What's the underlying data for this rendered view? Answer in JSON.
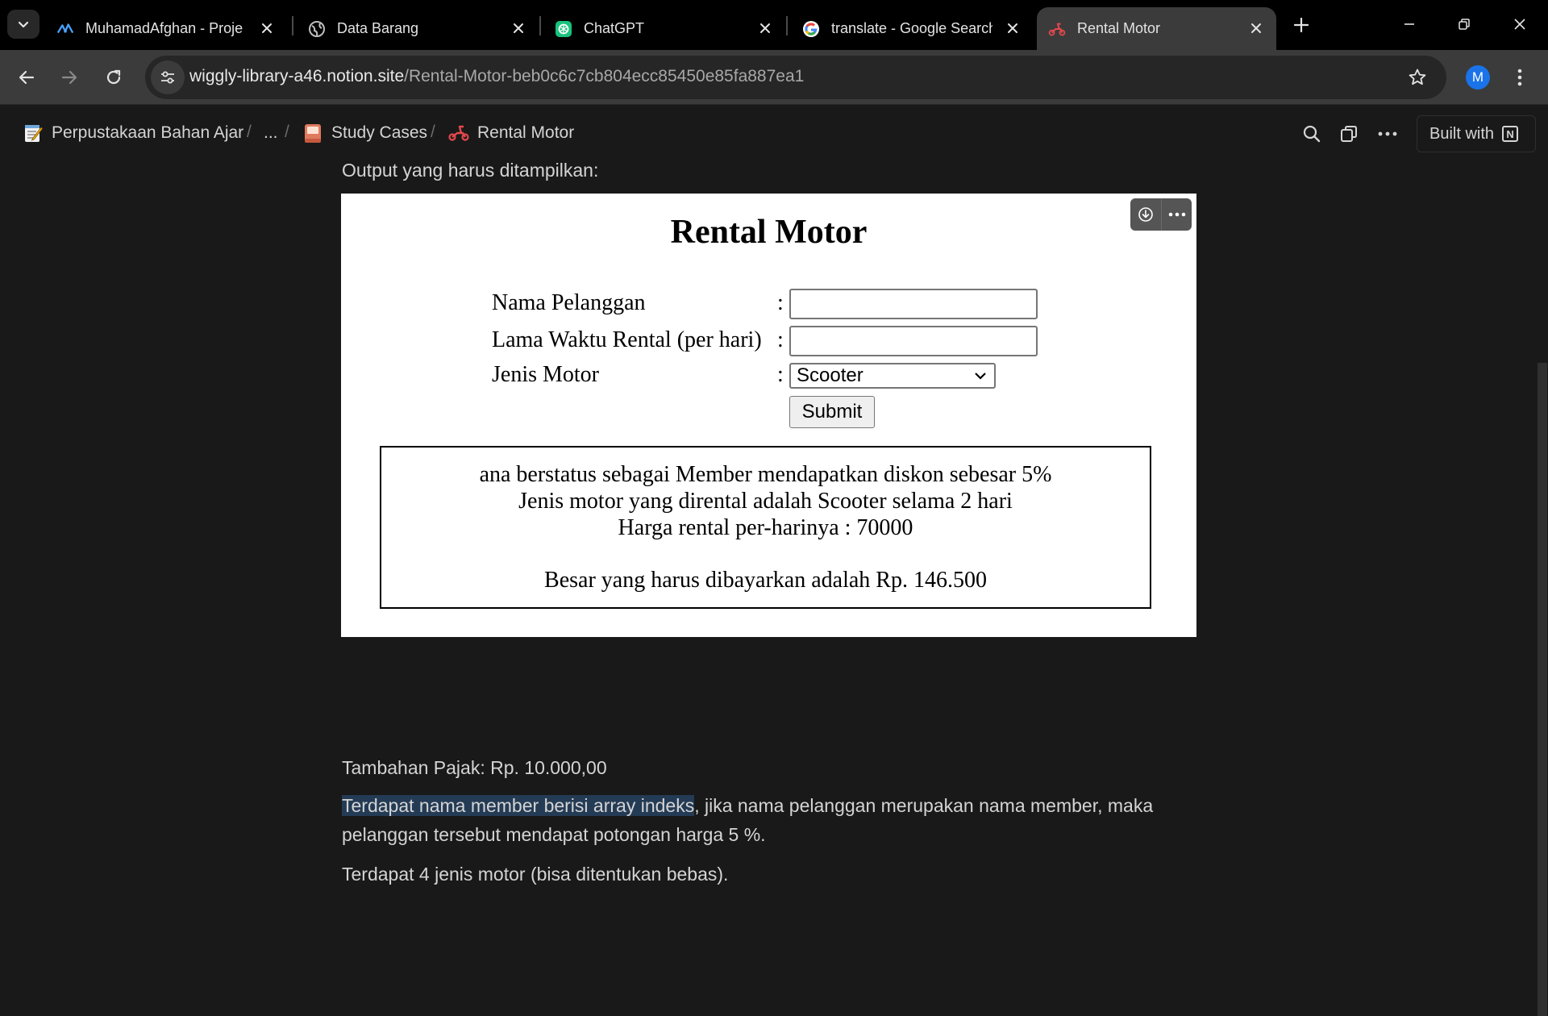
{
  "browser": {
    "tabs": [
      {
        "title": "MuhamadAfghan - Proje",
        "favicon": "blue-asterisk-icon",
        "active": false
      },
      {
        "title": "Data Barang",
        "favicon": "globe-icon",
        "active": false
      },
      {
        "title": "ChatGPT",
        "favicon": "chatgpt-icon",
        "active": false
      },
      {
        "title": "translate - Google Search",
        "favicon": "google-icon",
        "active": false
      },
      {
        "title": "Rental Motor",
        "favicon": "scooter-icon",
        "active": true
      }
    ],
    "url_host": "wiggly-library-a46.notion.site",
    "url_path": "/Rental-Motor-beb0c6c7cb804ecc85450e85fa887ea1",
    "profile_initial": "M",
    "accent_color": "#1a73e8"
  },
  "notion": {
    "breadcrumb": [
      {
        "label": "Perpustakaan Bahan Ajar",
        "icon": "memo-icon"
      },
      {
        "label": "...",
        "icon": ""
      },
      {
        "label": "Study Cases",
        "icon": "book-icon"
      },
      {
        "label": "Rental Motor",
        "icon": "scooter-icon"
      }
    ],
    "built_with_label": "Built with",
    "intro_text": "Output yang harus ditampilkan:",
    "paragraph_tax": "Tambahan Pajak: Rp. 10.000,00",
    "paragraph_member_highlight": "Terdapat nama member berisi array indeks",
    "paragraph_member_rest": ", jika nama pelanggan merupakan nama member, maka",
    "paragraph_member_line2": "pelanggan tersebut mendapat potongan harga 5 %.",
    "paragraph_types": "Terdapat 4 jenis motor (bisa ditentukan bebas).",
    "highlight_color": "#243b55"
  },
  "embed": {
    "title": "Rental Motor",
    "fields": [
      {
        "label": "Nama Pelanggan",
        "value": ""
      },
      {
        "label": "Lama Waktu Rental (per hari)",
        "value": ""
      }
    ],
    "select_label": "Jenis Motor",
    "select_value": "Scooter",
    "colon": ":",
    "submit_label": "Submit",
    "result_lines": [
      "ana berstatus sebagai Member mendapatkan diskon sebesar 5%",
      "Jenis motor yang dirental adalah Scooter selama 2 hari",
      "Harga rental per-harinya : 70000"
    ],
    "result_total": "Besar yang harus dibayarkan adalah Rp. 146.500"
  }
}
